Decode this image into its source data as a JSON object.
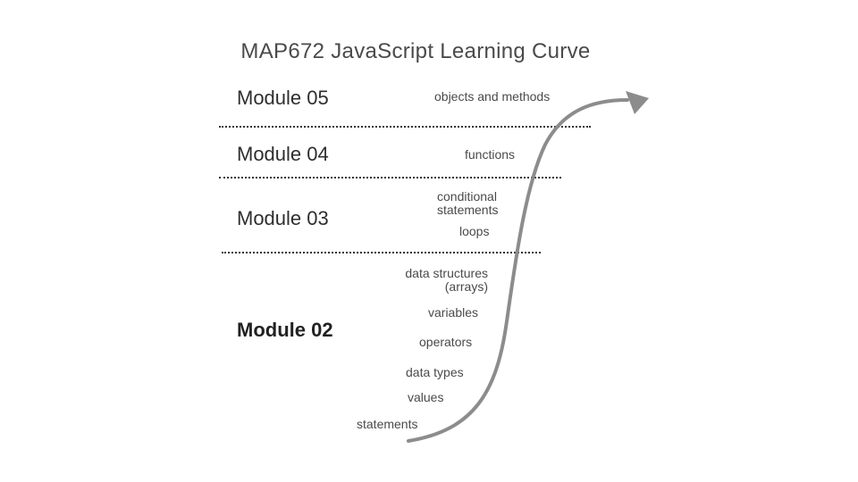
{
  "title": "MAP672 JavaScript Learning Curve",
  "modules": [
    {
      "label": "Module 05",
      "topics": [
        "objects and methods"
      ]
    },
    {
      "label": "Module 04",
      "topics": [
        "functions"
      ]
    },
    {
      "label": "Module 03",
      "topics": [
        "conditional statements",
        "loops"
      ]
    },
    {
      "label": "Module 02",
      "topics": [
        "data structures (arrays)",
        "variables",
        "operators",
        "data types",
        "values",
        "statements"
      ]
    }
  ],
  "colors": {
    "curve": "#8c8c8c",
    "divider": "#333333",
    "text": "#333333"
  },
  "icons": {
    "curve_arrow": "arrow-head"
  }
}
